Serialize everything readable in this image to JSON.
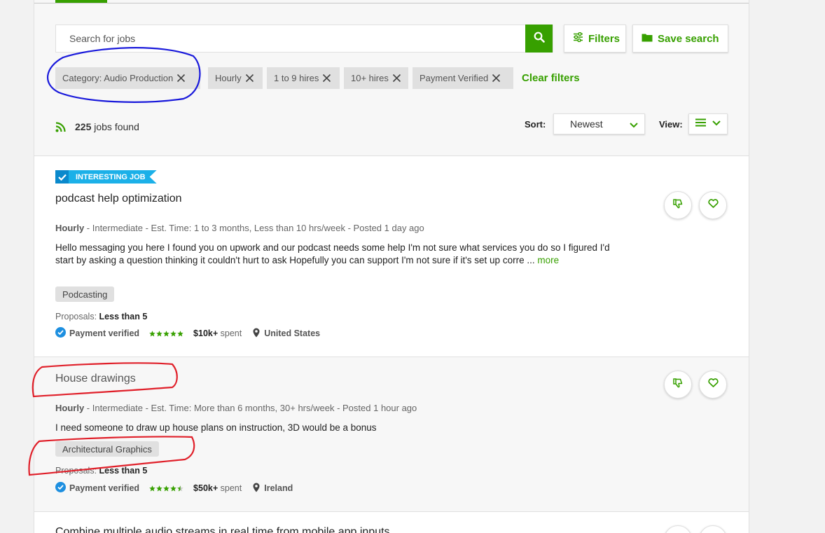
{
  "search": {
    "placeholder": "Search for jobs",
    "filters_label": "Filters",
    "save_search_label": "Save search"
  },
  "filters": {
    "chips": [
      {
        "label": "Category: Audio Production"
      },
      {
        "label": "Hourly"
      },
      {
        "label": "1 to 9 hires"
      },
      {
        "label": "10+ hires"
      },
      {
        "label": "Payment Verified"
      }
    ],
    "clear_label": "Clear filters"
  },
  "results": {
    "count": "225",
    "count_suffix": "jobs found",
    "sort_label": "Sort:",
    "sort_value": "Newest",
    "view_label": "View:"
  },
  "jobs": [
    {
      "badge": "INTERESTING JOB",
      "title": "podcast help optimization",
      "type": "Hourly",
      "meta": " - Intermediate - Est. Time: 1 to 3 months, Less than 10 hrs/week - Posted 1 day ago",
      "description": "Hello messaging you here I found you on upwork and our podcast needs some help I'm not sure what services you do so I figured I'd start by asking a question thinking it couldn't hurt to ask Hopefully you can support I'm not sure if it's set up corre ... ",
      "more_label": "more",
      "skill": "Podcasting",
      "proposals_label": "Proposals:",
      "proposals_value": "Less than 5",
      "payment_label": "Payment verified",
      "rating": 5,
      "spent_value": "$10k+",
      "spent_label": "spent",
      "location": "United States"
    },
    {
      "title": "House drawings",
      "type": "Hourly",
      "meta": " - Intermediate - Est. Time: More than 6 months, 30+ hrs/week - Posted 1 hour ago",
      "description": "I need someone to draw up house plans on instruction, 3D would be a bonus",
      "skill": "Architectural Graphics",
      "proposals_label": "Proposals:",
      "proposals_value": "Less than 5",
      "payment_label": "Payment verified",
      "rating": 4.5,
      "spent_value": "$50k+",
      "spent_label": "spent",
      "location": "Ireland"
    },
    {
      "title": "Combine multiple audio streams in real time from mobile app inputs"
    }
  ],
  "colors": {
    "brand_green": "#37a000",
    "badge_blue": "#1bb0e8",
    "annotation_blue": "#1a1adb",
    "annotation_red": "#e0202a"
  },
  "icons": [
    "search-icon",
    "chevron-down-icon",
    "sliders-icon",
    "folder-icon",
    "close-icon",
    "rss-icon",
    "list-icon",
    "check-icon",
    "thumbs-down-icon",
    "heart-icon",
    "verified-icon",
    "star-icon",
    "location-pin-icon"
  ]
}
